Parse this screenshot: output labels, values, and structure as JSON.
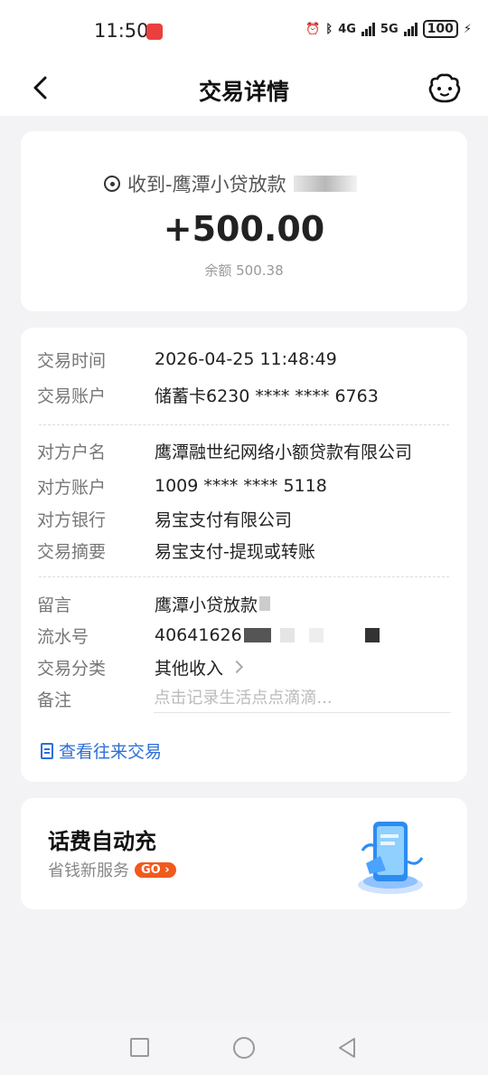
{
  "status_bar": {
    "time": "11:50",
    "battery": "100",
    "network_1": "4G",
    "network_2": "5G"
  },
  "nav": {
    "title": "交易详情"
  },
  "summary": {
    "counterparty_prefix": "收到-鹰潭小贷放款",
    "amount": "+500.00",
    "balance": "余额 500.38"
  },
  "details": {
    "rows_group1": [
      {
        "label": "交易时间",
        "value": "2026-04-25 11:48:49"
      },
      {
        "label": "交易账户",
        "value": "储蓄卡6230 **** **** 6763"
      }
    ],
    "rows_group2": [
      {
        "label": "对方户名",
        "value": "鹰潭融世纪网络小额贷款有限公司"
      },
      {
        "label": "对方账户",
        "value": "1009 **** **** 5118"
      },
      {
        "label": "对方银行",
        "value": "易宝支付有限公司"
      },
      {
        "label": "交易摘要",
        "value": "易宝支付-提现或转账"
      }
    ],
    "message_label": "留言",
    "message_value": "鹰潭小贷放款",
    "serial_label": "流水号",
    "serial_value": "40641626",
    "category_label": "交易分类",
    "category_value": "其他收入",
    "remark_label": "备注",
    "remark_placeholder": "点击记录生活点点滴滴...",
    "history_link": "查看往来交易"
  },
  "promo": {
    "title": "话费自动充",
    "subtitle": "省钱新服务",
    "go_label": "GO"
  },
  "colors": {
    "accent_blue": "#2d6fd6",
    "go_orange": "#f05a1d"
  }
}
